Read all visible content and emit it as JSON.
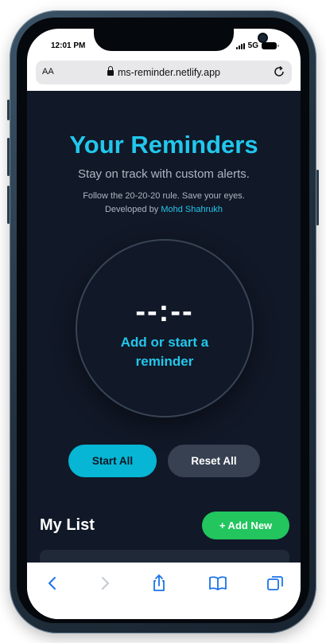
{
  "status": {
    "time": "12:01 PM",
    "network": "5G"
  },
  "browser": {
    "aa_label": "AA",
    "url": "ms-reminder.netlify.app"
  },
  "app": {
    "title": "Your Reminders",
    "subtitle": "Stay on track with custom alerts.",
    "tip_line": "Follow the 20-20-20 rule. Save your eyes.",
    "dev_prefix": "Developed by",
    "dev_name": "Mohd Shahrukh",
    "timer_display": "--:--",
    "circle_label": "Add or start a reminder",
    "start_all_label": "Start All",
    "reset_all_label": "Reset All",
    "my_list_heading": "My List",
    "add_new_label": "+ Add New"
  },
  "colors": {
    "accent": "#22c7ec",
    "background": "#111827",
    "start_button": "#06b6d4",
    "reset_button": "#374151",
    "add_button": "#22c55e",
    "safari_blue": "#1a73e8"
  },
  "toolbar": {
    "icons": [
      "back-icon",
      "forward-icon",
      "share-icon",
      "bookmarks-icon",
      "tabs-icon"
    ]
  }
}
